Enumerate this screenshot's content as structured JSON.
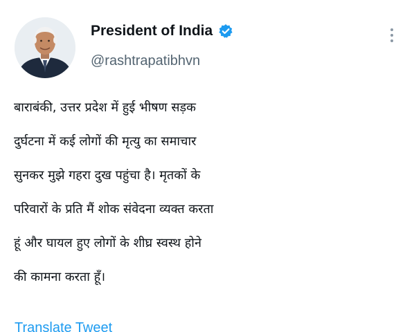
{
  "author": {
    "display_name": "President of India",
    "handle": "@rashtrapatibhvn",
    "verified": true,
    "avatar_icon": "profile-photo-icon",
    "verified_icon": "verified-badge-icon"
  },
  "menu": {
    "icon": "more-options-icon"
  },
  "tweet": {
    "lines": [
      "बाराबंकी, उत्तर प्रदेश में हुई भीषण सड़क",
      "दुर्घटना में कई लोगों की मृत्यु का समाचार",
      "सुनकर मुझे गहरा दुख पहुंचा है। मृतकों के",
      "परिवारों के प्रति मैं शोक संवेदना व्यक्त करता",
      "हूं और घायल हुए लोगों के शीघ्र स्वस्थ होने",
      "की कामना करता हूँ।"
    ],
    "translate_label": "Translate Tweet"
  },
  "colors": {
    "text": "#0f1419",
    "secondary_text": "#536471",
    "accent": "#1d9bf0",
    "verified_badge": "#1d9bf0",
    "background": "#ffffff"
  }
}
